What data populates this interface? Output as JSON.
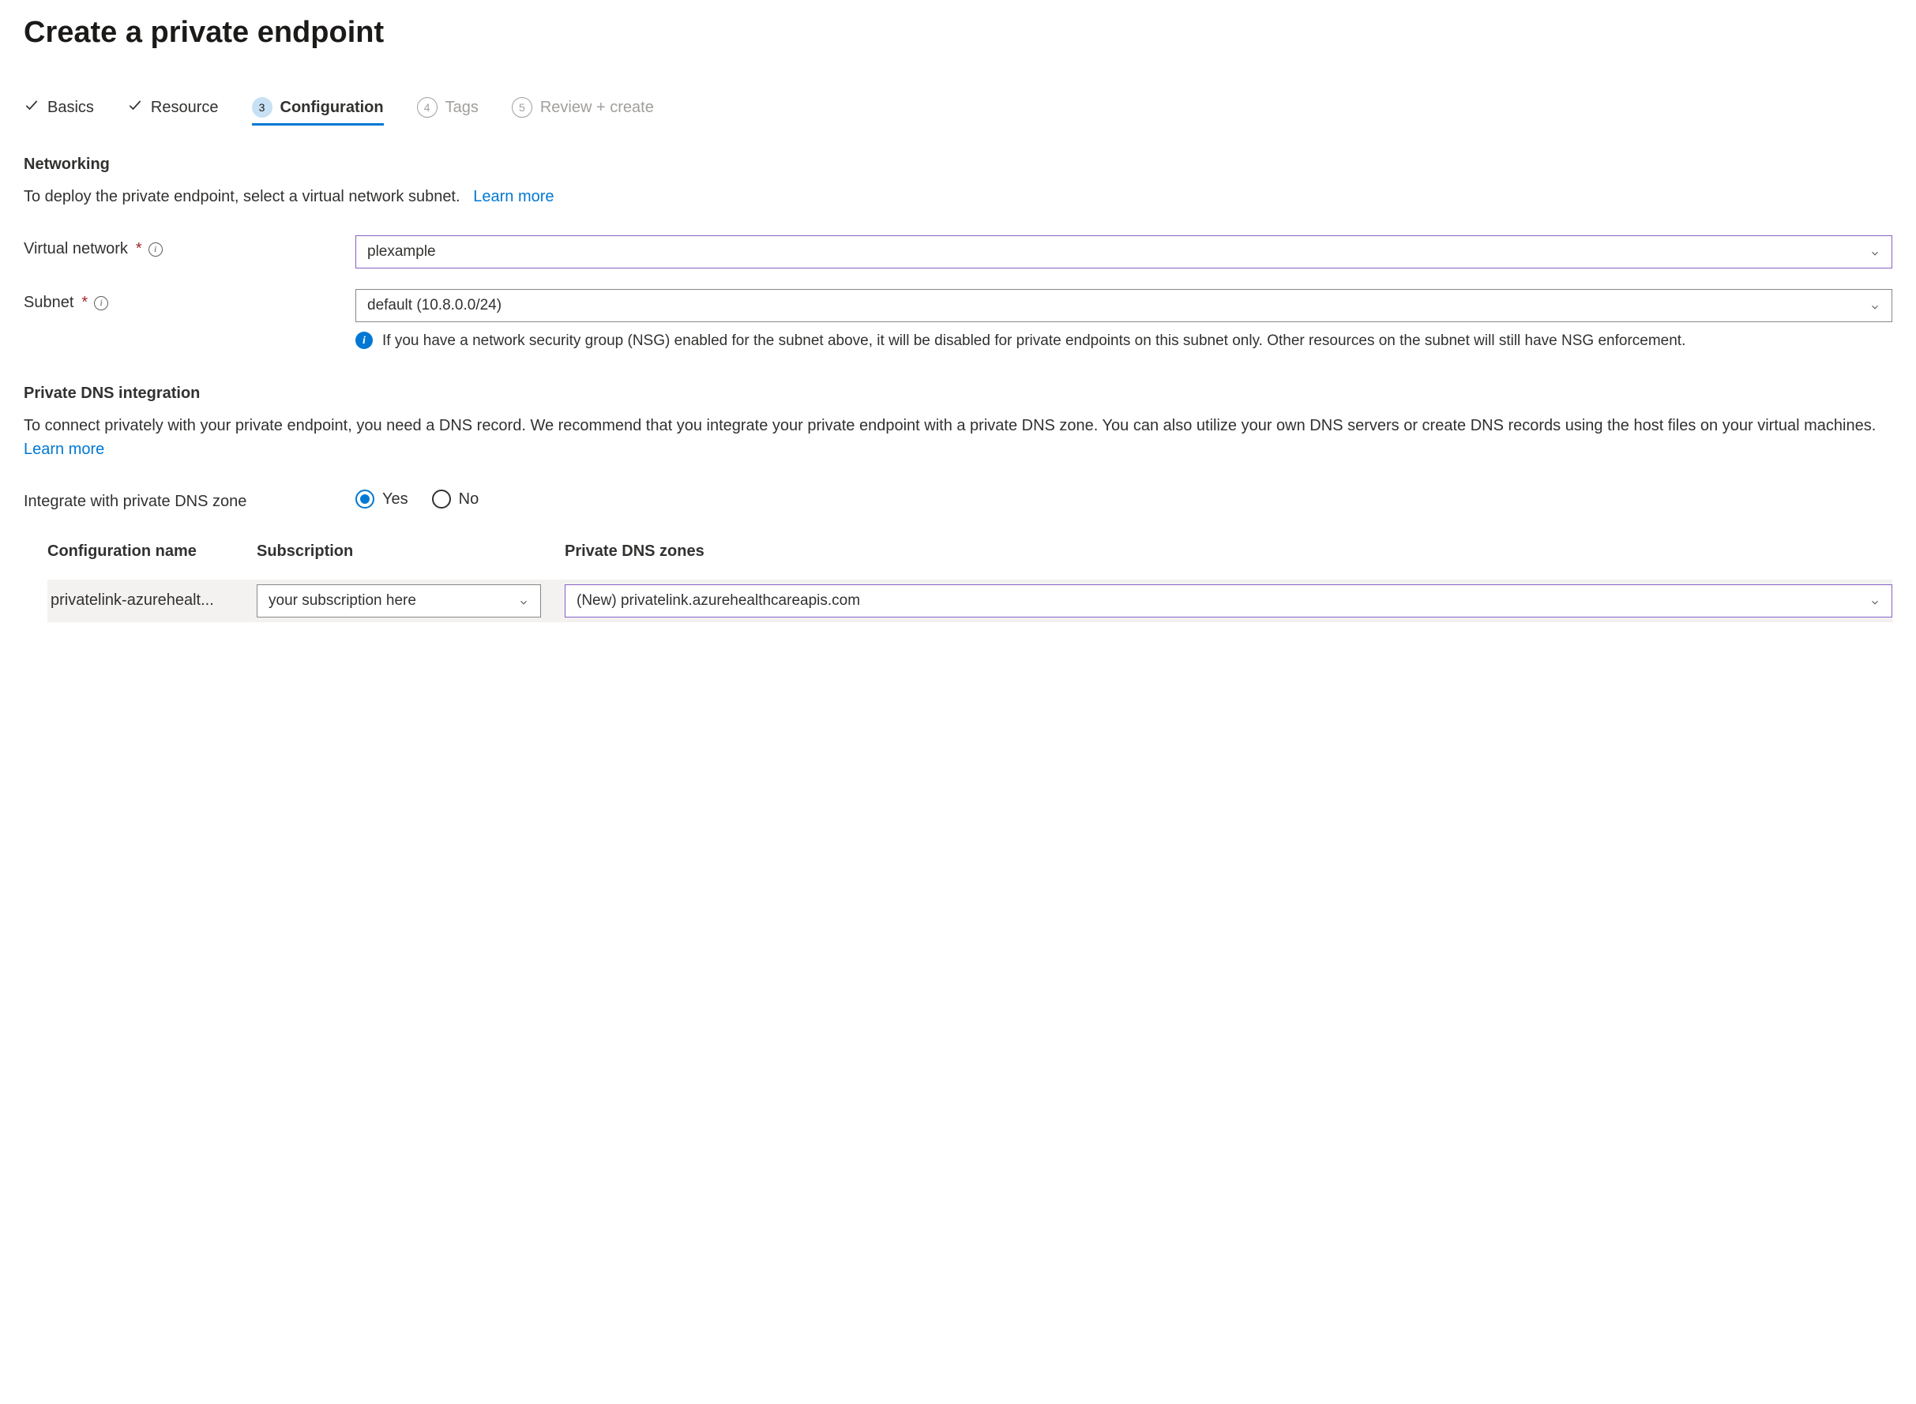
{
  "page_title": "Create a private endpoint",
  "tabs": [
    {
      "label": "Basics",
      "state": "done"
    },
    {
      "label": "Resource",
      "state": "done"
    },
    {
      "label": "Configuration",
      "state": "active",
      "number": "3"
    },
    {
      "label": "Tags",
      "state": "upcoming",
      "number": "4"
    },
    {
      "label": "Review + create",
      "state": "upcoming",
      "number": "5"
    }
  ],
  "networking": {
    "heading": "Networking",
    "description": "To deploy the private endpoint, select a virtual network subnet.",
    "learn_more": "Learn more",
    "vnet_label": "Virtual network",
    "vnet_value": "plexample",
    "subnet_label": "Subnet",
    "subnet_value": "default (10.8.0.0/24)",
    "nsg_note": "If you have a network security group (NSG) enabled for the subnet above, it will be disabled for private endpoints on this subnet only. Other resources on the subnet will still have NSG enforcement."
  },
  "dns": {
    "heading": "Private DNS integration",
    "description": "To connect privately with your private endpoint, you need a DNS record. We recommend that you integrate your private endpoint with a private DNS zone. You can also utilize your own DNS servers or create DNS records using the host files on your virtual machines.",
    "learn_more": "Learn more",
    "integrate_label": "Integrate with private DNS zone",
    "radio_yes": "Yes",
    "radio_no": "No",
    "table": {
      "col_config": "Configuration name",
      "col_sub": "Subscription",
      "col_zone": "Private DNS zones",
      "row": {
        "config_name": "privatelink-azurehealt...",
        "subscription": "your subscription here",
        "zone": "(New) privatelink.azurehealthcareapis.com"
      }
    }
  }
}
